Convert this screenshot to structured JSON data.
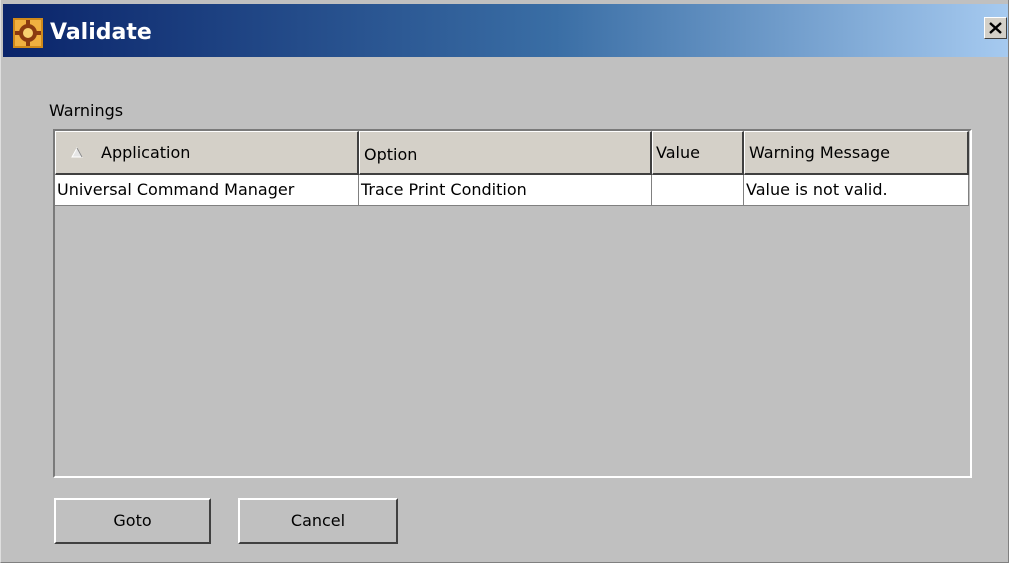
{
  "window": {
    "title": "Validate",
    "close_symbol": "✕",
    "icons": {
      "app": "validate-app-icon",
      "close": "close-icon"
    }
  },
  "warnings": {
    "label": "Warnings",
    "columns": [
      {
        "label": "Application",
        "sort": "ascending",
        "sort_icon": "sort-ascending-icon"
      },
      {
        "label": "Option"
      },
      {
        "label": "Value"
      },
      {
        "label": "Warning Message"
      }
    ],
    "rows": [
      {
        "application": "Universal Command Manager",
        "option": "Trace Print Condition",
        "value": "",
        "warning_message": "Value is not valid."
      }
    ]
  },
  "buttons": {
    "goto": "Goto",
    "cancel": "Cancel"
  },
  "colors": {
    "title_gradient_start": "#0a246a",
    "title_gradient_end": "#a6caf0",
    "dialog_face": "#c0c0c0",
    "cell_background": "#ffffff"
  }
}
